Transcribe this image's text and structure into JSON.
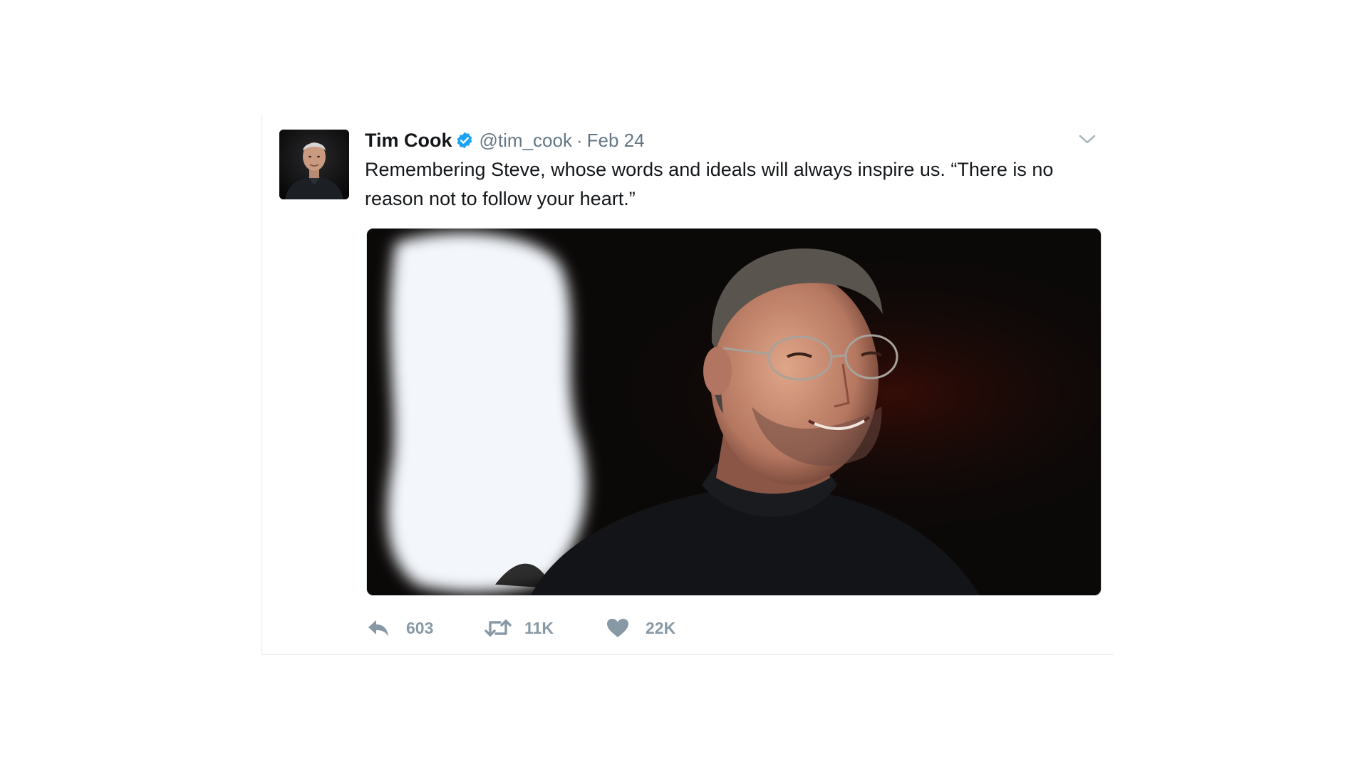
{
  "tweet": {
    "author": {
      "name": "Tim Cook",
      "handle": "@tim_cook",
      "verified": true
    },
    "separator": "·",
    "date": "Feb 24",
    "text": "Remembering Steve, whose words and ideals will always inspire us. “There is no reason not to follow your heart.”",
    "actions": {
      "reply_count": "603",
      "retweet_count": "11K",
      "like_count": "22K"
    }
  },
  "icons": {
    "verified": "verified-badge-icon",
    "caret": "chevron-down-icon",
    "reply": "reply-icon",
    "retweet": "retweet-icon",
    "like": "heart-icon"
  },
  "colors": {
    "verified_blue": "#1da1f2",
    "secondary_text": "#657786",
    "action_gray": "#8899a6",
    "border": "#e6ecf0"
  }
}
